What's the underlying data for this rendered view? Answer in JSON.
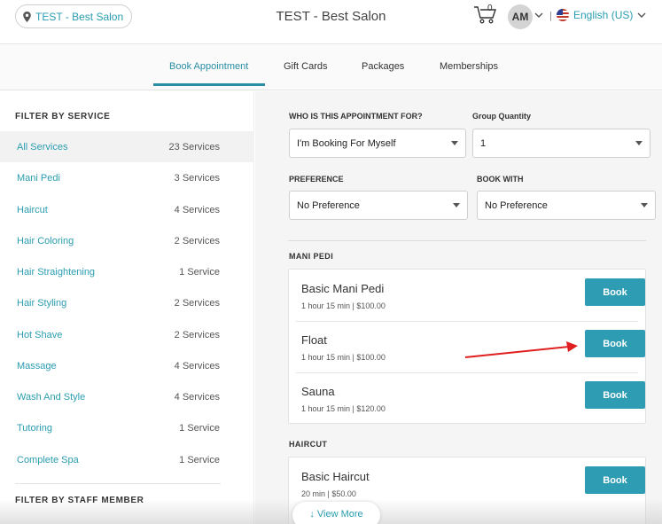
{
  "header": {
    "location_label": "TEST - Best Salon",
    "title": "TEST - Best Salon",
    "cart_count": "0",
    "avatar_initials": "AM",
    "separator": "|",
    "language": "English (US)"
  },
  "tabs": [
    {
      "label": "Book Appointment",
      "active": true
    },
    {
      "label": "Gift Cards"
    },
    {
      "label": "Packages"
    },
    {
      "label": "Memberships"
    }
  ],
  "sidebar": {
    "service_heading": "FILTER BY SERVICE",
    "services": [
      {
        "name": "All Services",
        "count": "23 Services",
        "selected": true
      },
      {
        "name": "Mani Pedi",
        "count": "3 Services"
      },
      {
        "name": "Haircut",
        "count": "4 Services"
      },
      {
        "name": "Hair Coloring",
        "count": "2 Services"
      },
      {
        "name": "Hair Straightening",
        "count": "1 Service"
      },
      {
        "name": "Hair Styling",
        "count": "2 Services"
      },
      {
        "name": "Hot Shave",
        "count": "2 Services"
      },
      {
        "name": "Massage",
        "count": "4 Services"
      },
      {
        "name": "Wash And Style",
        "count": "4 Services"
      },
      {
        "name": "Tutoring",
        "count": "1 Service"
      },
      {
        "name": "Complete Spa",
        "count": "1 Service"
      }
    ],
    "staff_heading": "FILTER BY STAFF MEMBER"
  },
  "form": {
    "who_label": "WHO IS THIS APPOINTMENT FOR?",
    "who_value": "I'm Booking For Myself",
    "qty_label": "Group Quantity",
    "qty_value": "1",
    "pref_label": "PREFERENCE",
    "pref_value": "No Preference",
    "with_label": "BOOK WITH",
    "with_value": "No Preference"
  },
  "categories": [
    {
      "heading": "MANI PEDI",
      "items": [
        {
          "name": "Basic Mani Pedi",
          "meta": "1 hour 15 min | $100.00",
          "button": "Book"
        },
        {
          "name": "Float",
          "meta": "1 hour 15 min | $100.00",
          "button": "Book"
        },
        {
          "name": "Sauna",
          "meta": "1 hour 15 min | $120.00",
          "button": "Book"
        }
      ]
    },
    {
      "heading": "HAIRCUT",
      "items": [
        {
          "name": "Basic Haircut",
          "meta": "20 min | $50.00",
          "button": "Book"
        }
      ]
    }
  ],
  "view_more": "↓ View More",
  "colors": {
    "accent": "#2a9db0",
    "button": "#2e9cb3",
    "annotation": "#e02020"
  }
}
